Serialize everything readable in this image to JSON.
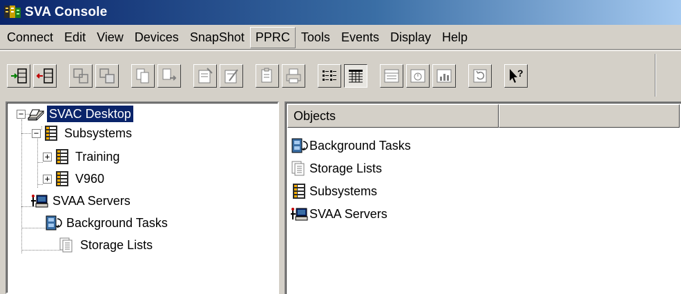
{
  "window": {
    "title": "SVA Console"
  },
  "menu": {
    "items": [
      {
        "label": "Connect"
      },
      {
        "label": "Edit"
      },
      {
        "label": "View"
      },
      {
        "label": "Devices"
      },
      {
        "label": "SnapShot"
      },
      {
        "label": "PPRC",
        "active": true
      },
      {
        "label": "Tools"
      },
      {
        "label": "Events"
      },
      {
        "label": "Display"
      },
      {
        "label": "Help"
      }
    ]
  },
  "toolbar": {
    "buttons": [
      {
        "icon": "connect-icon"
      },
      {
        "icon": "disconnect-icon"
      },
      {
        "icon": "snapshot-icon"
      },
      {
        "icon": "snapshot-copy-icon"
      },
      {
        "icon": "copy-icon"
      },
      {
        "icon": "move-icon"
      },
      {
        "icon": "properties-icon"
      },
      {
        "icon": "edit-properties-icon"
      },
      {
        "icon": "paste-icon"
      },
      {
        "icon": "print-icon"
      },
      {
        "icon": "list-view-icon"
      },
      {
        "icon": "details-view-icon",
        "pressed": true
      },
      {
        "icon": "panel-icon"
      },
      {
        "icon": "gauge-icon"
      },
      {
        "icon": "chart-icon"
      },
      {
        "icon": "refresh-icon"
      },
      {
        "icon": "help-pointer-icon"
      }
    ]
  },
  "tree": {
    "root": {
      "label": "SVAC Desktop",
      "selected": true
    },
    "subsystems": {
      "label": "Subsystems"
    },
    "training": {
      "label": "Training"
    },
    "v960": {
      "label": "V960"
    },
    "svaa_servers": {
      "label": "SVAA Servers"
    },
    "background_tasks": {
      "label": "Background Tasks"
    },
    "storage_lists": {
      "label": "Storage Lists"
    }
  },
  "list": {
    "columns": [
      {
        "label": "Objects"
      },
      {
        "label": ""
      }
    ],
    "items": [
      {
        "label": "Background Tasks",
        "icon": "background-tasks-icon"
      },
      {
        "label": "Storage Lists",
        "icon": "storage-lists-icon"
      },
      {
        "label": "Subsystems",
        "icon": "subsystems-icon"
      },
      {
        "label": "SVAA Servers",
        "icon": "svaa-servers-icon"
      }
    ]
  },
  "colors": {
    "titlebar_start": "#0a246a",
    "titlebar_end": "#a6caf0",
    "face": "#d4d0c8",
    "selection": "#0a246a"
  }
}
